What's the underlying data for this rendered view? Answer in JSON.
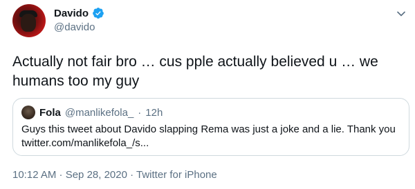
{
  "author": {
    "display_name": "Davido",
    "handle": "@davido",
    "verified_badge_color": "#1da1f2"
  },
  "tweet": {
    "text": "Actually not fair bro … cus pple actually believed u … we humans too my guy"
  },
  "quote": {
    "display_name": "Fola",
    "handle": "@manlikefola_",
    "separator": "·",
    "time": "12h",
    "text_line_1": "Guys this tweet about Davido slapping Rema was just a joke and a lie. Thank you",
    "text_line_2": "twitter.com/manlikefola_/s..."
  },
  "meta": {
    "line": "10:12 AM · Sep 28, 2020 · Twitter for iPhone"
  },
  "colors": {
    "secondary_text": "#5b7083",
    "border": "#cfd9de"
  },
  "icons": {
    "verified": "verified-badge-icon",
    "more": "chevron-down-icon"
  }
}
